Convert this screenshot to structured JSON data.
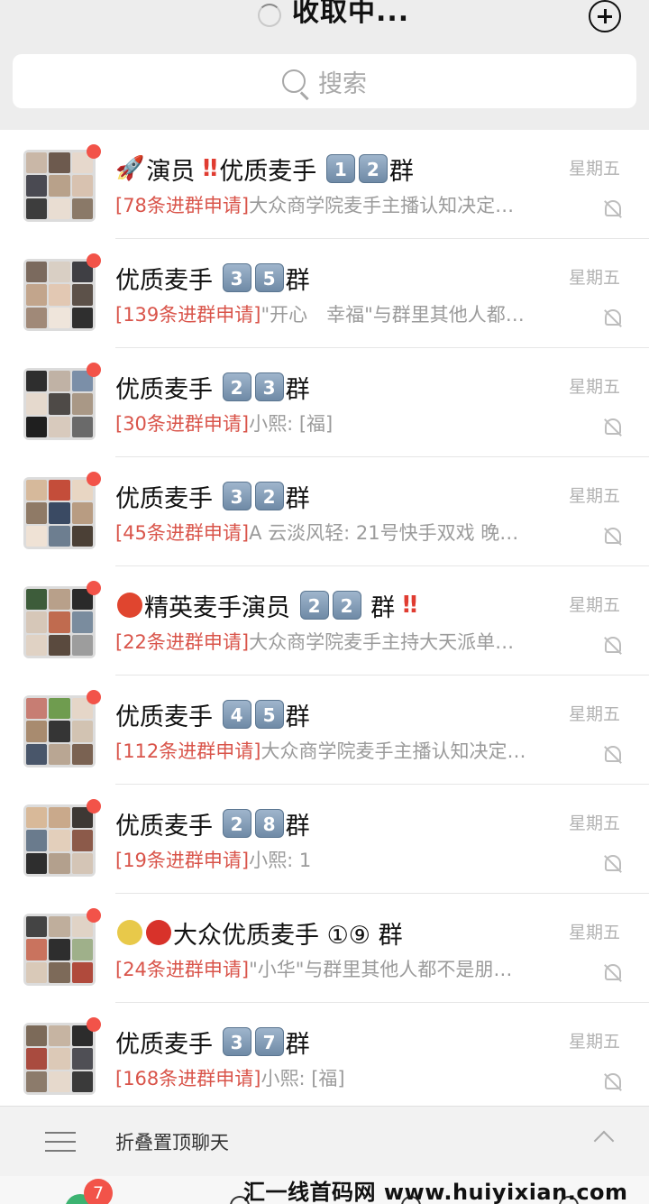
{
  "header": {
    "title": "收取中..."
  },
  "search": {
    "placeholder": "搜索"
  },
  "chats": [
    {
      "name_parts": [
        {
          "t": "emo",
          "v": "🚀"
        },
        {
          "t": "txt",
          "v": "演员 "
        },
        {
          "t": "red",
          "v": "‼"
        },
        {
          "t": "txt",
          "v": "优质麦手 "
        },
        {
          "t": "key",
          "v": "1"
        },
        {
          "t": "key",
          "v": "2"
        },
        {
          "t": "txt",
          "v": "群"
        }
      ],
      "request": "[78条进群申请]",
      "preview": "大众商学院麦手主播认知决定…",
      "time": "星期五"
    },
    {
      "name_parts": [
        {
          "t": "txt",
          "v": "优质麦手 "
        },
        {
          "t": "key",
          "v": "3"
        },
        {
          "t": "key",
          "v": "5"
        },
        {
          "t": "txt",
          "v": "群"
        }
      ],
      "request": "[139条进群申请]",
      "preview": "\"开心　幸福\"与群里其他人都…",
      "time": "星期五"
    },
    {
      "name_parts": [
        {
          "t": "txt",
          "v": "优质麦手 "
        },
        {
          "t": "key",
          "v": "2"
        },
        {
          "t": "key",
          "v": "3"
        },
        {
          "t": "txt",
          "v": "群"
        }
      ],
      "request": "[30条进群申请]",
      "preview": "小熙: [福]",
      "time": "星期五"
    },
    {
      "name_parts": [
        {
          "t": "txt",
          "v": "优质麦手 "
        },
        {
          "t": "key",
          "v": "3"
        },
        {
          "t": "key",
          "v": "2"
        },
        {
          "t": "txt",
          "v": "群"
        }
      ],
      "request": "[45条进群申请]",
      "preview": "A 云淡风轻: 21号快手双戏  晚…",
      "time": "星期五"
    },
    {
      "name_parts": [
        {
          "t": "stop",
          "v": ""
        },
        {
          "t": "txt",
          "v": "精英麦手演员 "
        },
        {
          "t": "key",
          "v": "2"
        },
        {
          "t": "key",
          "v": "2"
        },
        {
          "t": "txt",
          "v": " 群 "
        },
        {
          "t": "red",
          "v": "‼"
        }
      ],
      "request": "[22条进群申请]",
      "preview": "大众商学院麦手主持大天派单…",
      "time": "星期五"
    },
    {
      "name_parts": [
        {
          "t": "txt",
          "v": "优质麦手 "
        },
        {
          "t": "key",
          "v": "4"
        },
        {
          "t": "key",
          "v": "5"
        },
        {
          "t": "txt",
          "v": "群"
        }
      ],
      "request": "[112条进群申请]",
      "preview": "大众商学院麦手主播认知决定…",
      "time": "星期五"
    },
    {
      "name_parts": [
        {
          "t": "txt",
          "v": "优质麦手 "
        },
        {
          "t": "key",
          "v": "2"
        },
        {
          "t": "key",
          "v": "8"
        },
        {
          "t": "txt",
          "v": "群"
        }
      ],
      "request": "[19条进群申请]",
      "preview": "小熙: 1",
      "time": "星期五"
    },
    {
      "name_parts": [
        {
          "t": "moon",
          "v": ""
        },
        {
          "t": "reddot",
          "v": ""
        },
        {
          "t": "txt",
          "v": "大众优质麦手 ①⑨ 群"
        }
      ],
      "request": "[24条进群申请]",
      "preview": "\"小华\"与群里其他人都不是朋…",
      "time": "星期五"
    },
    {
      "name_parts": [
        {
          "t": "txt",
          "v": "优质麦手 "
        },
        {
          "t": "key",
          "v": "3"
        },
        {
          "t": "key",
          "v": "7"
        },
        {
          "t": "txt",
          "v": "群"
        }
      ],
      "request": "[168条进群申请]",
      "preview": "小熙: [福]",
      "time": "星期五"
    }
  ],
  "folded": {
    "label": "折叠置顶聊天"
  },
  "tabbar": {
    "badge": "7"
  },
  "watermark": "汇一线首码网 www.huiyixian.com",
  "colors": {
    "accent_red": "#f25349",
    "request_red": "#d9544a",
    "background": "#ededed"
  }
}
